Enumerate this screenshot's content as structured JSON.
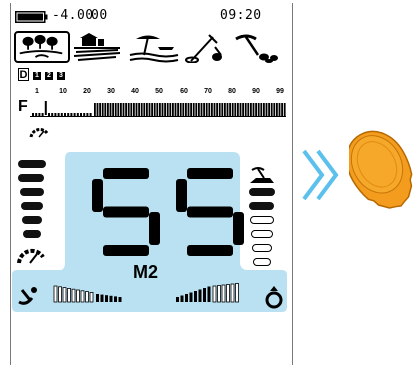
{
  "status_bar": {
    "frequency": "-4.00",
    "tone": "00",
    "clock": "09:20",
    "battery_level": 1.0
  },
  "modes": [
    {
      "name": "park-icon",
      "selected": true
    },
    {
      "name": "field-icon",
      "selected": false
    },
    {
      "name": "beach-icon",
      "selected": false
    },
    {
      "name": "metal-detector-icon",
      "selected": false
    },
    {
      "name": "pickaxe-icon",
      "selected": false
    }
  ],
  "discrimination": {
    "label": "D",
    "items": [
      "1",
      "2",
      "3"
    ]
  },
  "scale": {
    "label": "F",
    "ticks": [
      "1",
      "10",
      "20",
      "30",
      "40",
      "50",
      "60",
      "70",
      "80",
      "90",
      "99"
    ]
  },
  "target_id": {
    "value": "55",
    "unit": "M2"
  },
  "depth_bars": {
    "filled": 6,
    "total": 6
  },
  "right_bars": {
    "filled": 3,
    "total": 6
  },
  "signal": {
    "left_level": 0.35,
    "right_level": 0.55
  },
  "colors": {
    "panel_blue": "#b9e1f1",
    "chevron_blue": "#5cc0ec",
    "coin_orange": "#f39c1d"
  },
  "target_icon": "bottle-cap-icon"
}
